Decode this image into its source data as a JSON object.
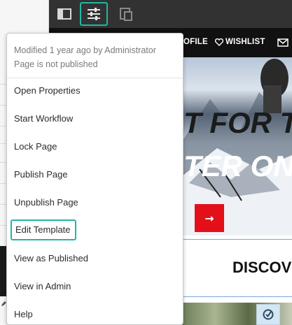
{
  "toolbar": {
    "icons": [
      "side-panel-icon",
      "page-properties-icon",
      "emulator-icon"
    ],
    "active_icon": "page-properties-icon",
    "accent": "#20b7a5",
    "background": "#323232"
  },
  "page_menu": {
    "meta": {
      "modified": "Modified 1 year ago by Administrator",
      "publish_status": "Page is not published"
    },
    "items": [
      {
        "label": "Open Properties"
      },
      {
        "label": "Start Workflow"
      },
      {
        "label": "Lock Page"
      },
      {
        "label": "Publish Page"
      },
      {
        "label": "Unpublish Page"
      },
      {
        "label": "Edit Template",
        "highlighted": true
      },
      {
        "label": "View as Published"
      },
      {
        "label": "View in Admin"
      },
      {
        "label": "Help"
      }
    ]
  },
  "site_preview": {
    "nav": {
      "profile_partial": "OFILE",
      "wishlist": "WISHLIST"
    },
    "hero": {
      "line1_partial": "T FOR T",
      "line2_partial": "TER ON",
      "accent": "#e3101a"
    },
    "section_heading_partial": "DISCOV"
  }
}
